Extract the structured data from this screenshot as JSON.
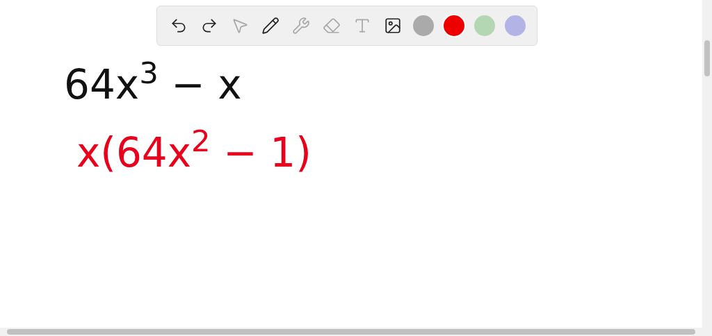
{
  "toolbar": {
    "tools": [
      {
        "kind": "undo",
        "disabled": false
      },
      {
        "kind": "redo",
        "disabled": false
      },
      {
        "kind": "pointer",
        "disabled": true
      },
      {
        "kind": "pencil",
        "disabled": false
      },
      {
        "kind": "tools",
        "disabled": true
      },
      {
        "kind": "eraser",
        "disabled": true
      },
      {
        "kind": "text",
        "disabled": true
      },
      {
        "kind": "image",
        "disabled": false
      }
    ],
    "colors": [
      {
        "color": "#aaaaaa",
        "selected": false
      },
      {
        "color": "#ee0000",
        "selected": true
      },
      {
        "color": "#b3d6b3",
        "selected": false
      },
      {
        "color": "#b3b3e6",
        "selected": false
      }
    ]
  },
  "canvas": {
    "lines": [
      {
        "text": "64x$^{3}$ − x",
        "color": "#111111"
      },
      {
        "text": "x(64x$^{2}$ − 1)",
        "color": "#e8001c"
      }
    ]
  }
}
